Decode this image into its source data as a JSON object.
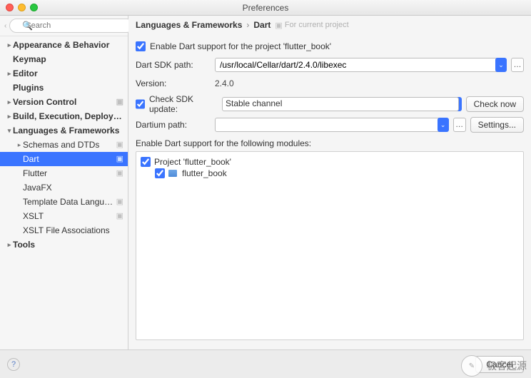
{
  "window": {
    "title": "Preferences"
  },
  "sidebar": {
    "search_placeholder": "Search",
    "items": [
      {
        "label": "Appearance & Behavior",
        "bold": true,
        "arrow": "▸",
        "indent": 0
      },
      {
        "label": "Keymap",
        "bold": true,
        "arrow": "",
        "indent": 0
      },
      {
        "label": "Editor",
        "bold": true,
        "arrow": "▸",
        "indent": 0
      },
      {
        "label": "Plugins",
        "bold": true,
        "arrow": "",
        "indent": 0
      },
      {
        "label": "Version Control",
        "bold": true,
        "arrow": "▸",
        "indent": 0,
        "badge": true
      },
      {
        "label": "Build, Execution, Deployment",
        "bold": true,
        "arrow": "▸",
        "indent": 0
      },
      {
        "label": "Languages & Frameworks",
        "bold": true,
        "arrow": "▾",
        "indent": 0
      },
      {
        "label": "Schemas and DTDs",
        "bold": false,
        "arrow": "▸",
        "indent": 1,
        "badge": true
      },
      {
        "label": "Dart",
        "bold": false,
        "arrow": "",
        "indent": 1,
        "badge": true,
        "selected": true
      },
      {
        "label": "Flutter",
        "bold": false,
        "arrow": "",
        "indent": 1,
        "badge": true
      },
      {
        "label": "JavaFX",
        "bold": false,
        "arrow": "",
        "indent": 1
      },
      {
        "label": "Template Data Languages",
        "bold": false,
        "arrow": "",
        "indent": 1,
        "badge": true
      },
      {
        "label": "XSLT",
        "bold": false,
        "arrow": "",
        "indent": 1,
        "badge": true
      },
      {
        "label": "XSLT File Associations",
        "bold": false,
        "arrow": "",
        "indent": 1
      },
      {
        "label": "Tools",
        "bold": true,
        "arrow": "▸",
        "indent": 0
      }
    ]
  },
  "breadcrumb": {
    "root": "Languages & Frameworks",
    "current": "Dart",
    "project_note": "For current project"
  },
  "form": {
    "enable_label": "Enable Dart support for the project 'flutter_book'",
    "enable_checked": true,
    "sdk_path_label": "Dart SDK path:",
    "sdk_path_value": "/usr/local/Cellar/dart/2.4.0/libexec",
    "version_label": "Version:",
    "version_value": "2.4.0",
    "check_sdk_label": "Check SDK update:",
    "check_sdk_checked": true,
    "channel_value": "Stable channel",
    "check_now": "Check now",
    "dartium_label": "Dartium path:",
    "dartium_value": "",
    "settings_btn": "Settings...",
    "modules_label": "Enable Dart support for the following modules:",
    "module_project": "Project 'flutter_book'",
    "module_child": "flutter_book"
  },
  "footer": {
    "cancel": "Cancel"
  },
  "watermark": {
    "text": "极客起源"
  }
}
